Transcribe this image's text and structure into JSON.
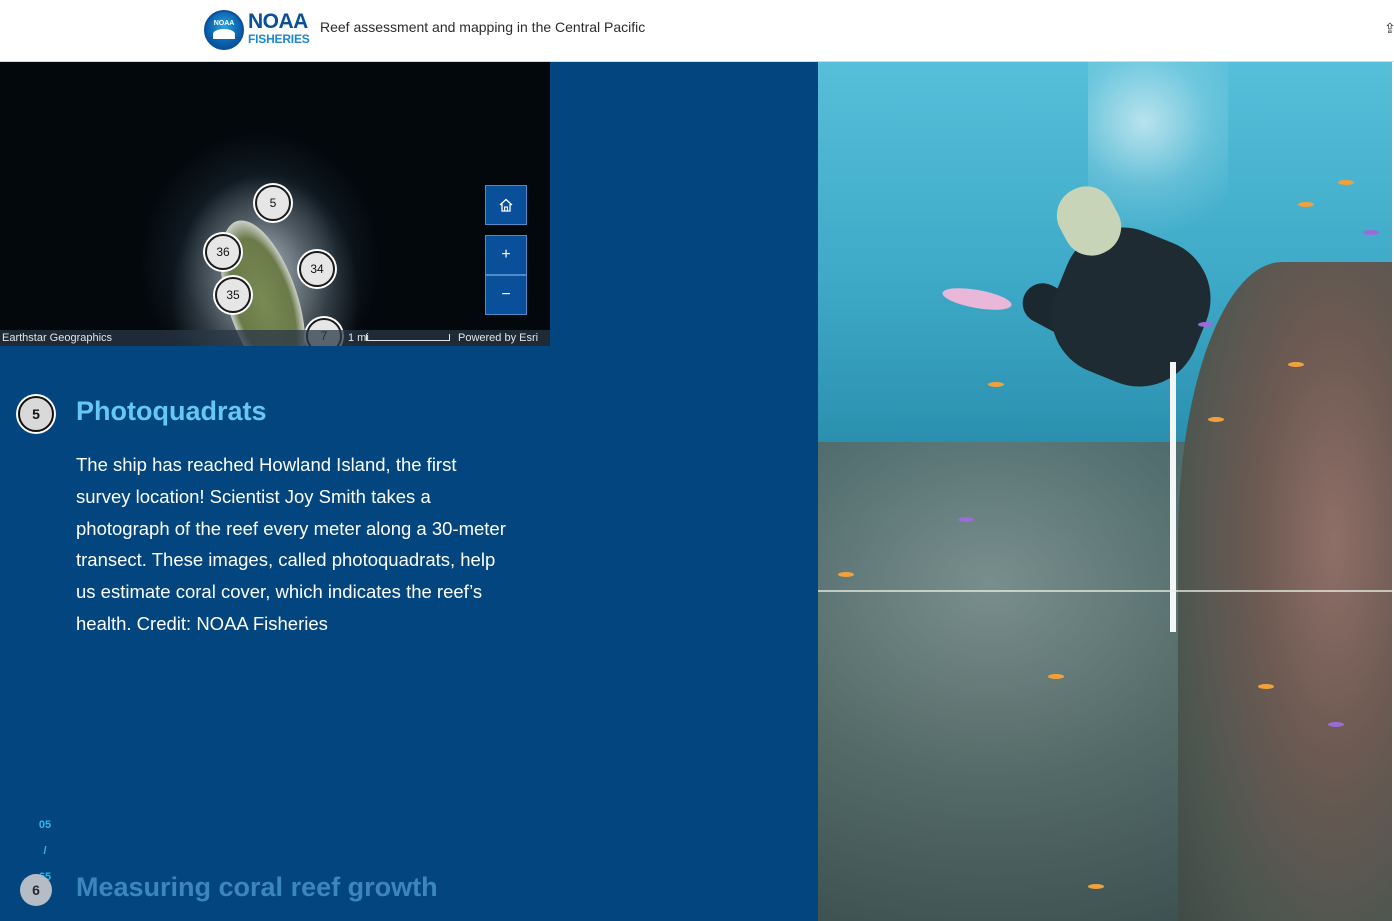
{
  "header": {
    "logo_seal": "NOAA",
    "logo_word_1": "NOAA",
    "logo_word_2": "FISHERIES",
    "title": "Reef assessment and mapping in the Central Pacific"
  },
  "map": {
    "markers": [
      "5",
      "36",
      "34",
      "35",
      "7"
    ],
    "home_icon": "home-icon",
    "zoom_in_label": "+",
    "zoom_out_label": "−",
    "attribution_left": "Earthstar Geographics",
    "scale_label": "1 mi",
    "attribution_right": "Powered by Esri"
  },
  "section": {
    "number": "5",
    "title": "Photoquadrats",
    "body": "The ship has reached Howland Island, the first survey location! Scientist Joy Smith takes a photograph of the reef every meter along a 30-meter transect. These images, called photoquadrats, help us estimate coral cover, which indicates the reef’s health. Credit: NOAA Fisheries"
  },
  "progress": {
    "current": "05",
    "separator": "/",
    "total": "65"
  },
  "next_section": {
    "number": "6",
    "title": "Measuring coral reef growth"
  },
  "colors": {
    "panel_bg": "#03467f",
    "title_accent": "#66c7f2",
    "progress_accent": "#2fb6ea"
  }
}
